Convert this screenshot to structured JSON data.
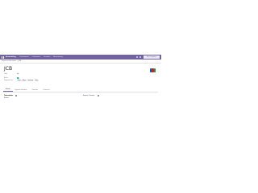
{
  "navbar": {
    "brand": "Accounting",
    "menus": [
      "Dashboard",
      "Customers",
      "Vendors",
      "Accounting"
    ],
    "company": "My Company",
    "color": "#71639e"
  },
  "breadcrumb": {
    "parent": "Payment Methods",
    "current": "JCB"
  },
  "form": {
    "title": "JCB",
    "fields": [
      {
        "label": "Code",
        "value": "jcb"
      },
      {
        "label": "Active",
        "value": ""
      }
    ],
    "supported_label": "Supported by",
    "tags": [
      "Stripe",
      "Adyen",
      "Buckaroo",
      "Mollie"
    ],
    "tabs": [
      "Brands",
      "Payment Providers",
      "Countries",
      "Currencies"
    ],
    "bottom_left_label": "Tokenization",
    "bottom_right_label": "Express Checkout",
    "bottom_sub_label": "Refund"
  }
}
